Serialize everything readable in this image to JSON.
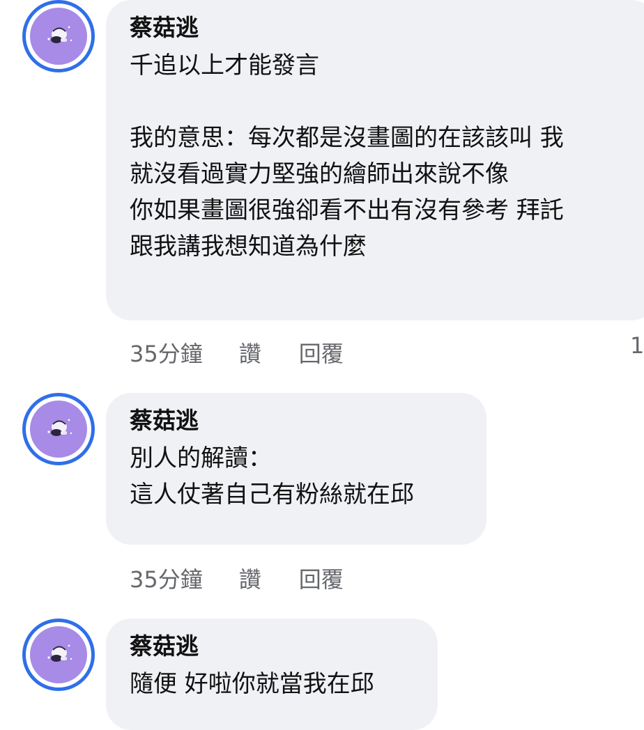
{
  "comments": [
    {
      "author": "蔡菇逃",
      "avatar_icon": "character-sticker-avatar",
      "lines": [
        "千追以上才能發言",
        "",
        "我的意思：每次都是沒畫圖的在該該叫 我",
        "就沒看過實力堅強的繪師出來說不像",
        "你如果畫圖很強卻看不出有沒有參考 拜託",
        "跟我講我想知道為什麼"
      ],
      "time": "35分鐘",
      "like_label": "讚",
      "reply_label": "回覆",
      "reaction_count": "1"
    },
    {
      "author": "蔡菇逃",
      "avatar_icon": "character-sticker-avatar",
      "lines": [
        "別人的解讀：",
        "這人仗著自己有粉絲就在邱"
      ],
      "time": "35分鐘",
      "like_label": "讚",
      "reply_label": "回覆"
    },
    {
      "author": "蔡菇逃",
      "avatar_icon": "character-sticker-avatar",
      "lines": [
        "隨便 好啦你就當我在邱"
      ]
    }
  ],
  "colors": {
    "avatar_ring": "#2f6fe8",
    "avatar_bg": "#a78be6",
    "bubble_bg": "#f0f1f5",
    "meta_text": "#65676b"
  }
}
